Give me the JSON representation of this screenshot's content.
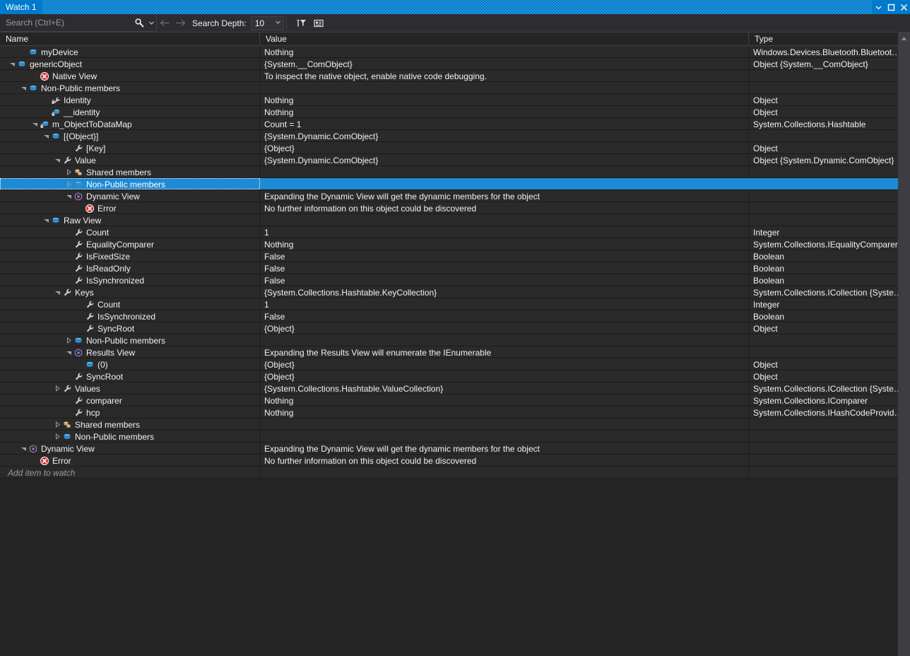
{
  "window": {
    "title": "Watch 1",
    "buttons": {
      "dropdown": "window-dropdown",
      "maximize": "maximize",
      "close": "close"
    }
  },
  "toolbar": {
    "search_placeholder": "Search (Ctrl+E)",
    "search_value": "",
    "search_icon": "magnifier-icon",
    "search_dropdown_icon": "chevron-down-icon",
    "back_icon": "arrow-left-icon",
    "forward_icon": "arrow-right-icon",
    "depth_label": "Search Depth:",
    "depth_value": "10",
    "pin_filter_icon": "pin-filter-icon",
    "hex_display_icon": "hexadecimal-display-icon"
  },
  "colors": {
    "accent": "#007acc",
    "selection": "#1e8ad6",
    "row_bg": "#2a2a2b",
    "panel_bg": "#252526",
    "toolbar_bg": "#2d2d30",
    "grid_line": "#1c1c1c",
    "text": "#f1f1f1",
    "muted_text": "#9a9a9a",
    "error_red": "#cf2b2b",
    "dynamic_purple": "#a074c4",
    "field_blue": "#3f9fe0",
    "property_gray": "#c5c5c5",
    "shared_tan": "#e8c39e"
  },
  "columns": [
    {
      "key": "name",
      "label": "Name"
    },
    {
      "key": "value",
      "label": "Value"
    },
    {
      "key": "type",
      "label": "Type"
    }
  ],
  "rows": [
    {
      "depth": 1,
      "expander": "none",
      "icon": "field-icon",
      "name": "myDevice",
      "value": "Nothing",
      "type": "Windows.Devices.Bluetooth.Bluetoot…"
    },
    {
      "depth": 0,
      "expander": "expanded",
      "icon": "field-icon",
      "name": "genericObject",
      "value": "{System.__ComObject}",
      "type": "Object {System.__ComObject}"
    },
    {
      "depth": 2,
      "expander": "none",
      "icon": "error-icon",
      "name": "Native View",
      "value": "To inspect the native object, enable native code debugging.",
      "type": ""
    },
    {
      "depth": 1,
      "expander": "expanded",
      "icon": "field-icon",
      "name": "Non-Public members",
      "value": "",
      "type": ""
    },
    {
      "depth": 3,
      "expander": "none",
      "icon": "private-property-icon",
      "name": "Identity",
      "value": "Nothing",
      "type": "Object"
    },
    {
      "depth": 3,
      "expander": "none",
      "icon": "private-field-icon",
      "name": "__identity",
      "value": "Nothing",
      "type": "Object"
    },
    {
      "depth": 2,
      "expander": "expanded",
      "icon": "private-field-icon",
      "name": "m_ObjectToDataMap",
      "value": "Count = 1",
      "type": "System.Collections.Hashtable"
    },
    {
      "depth": 3,
      "expander": "expanded",
      "icon": "field-icon",
      "name": "[{Object}]",
      "value": "{System.Dynamic.ComObject}",
      "type": ""
    },
    {
      "depth": 5,
      "expander": "none",
      "icon": "property-icon",
      "name": "[Key]",
      "value": "{Object}",
      "type": "Object"
    },
    {
      "depth": 4,
      "expander": "expanded",
      "icon": "property-icon",
      "name": "Value",
      "value": "{System.Dynamic.ComObject}",
      "type": "Object {System.Dynamic.ComObject}"
    },
    {
      "depth": 5,
      "expander": "collapsed",
      "icon": "shared-members-icon",
      "name": "Shared members",
      "value": "",
      "type": ""
    },
    {
      "depth": 5,
      "expander": "collapsed",
      "icon": "field-icon",
      "name": "Non-Public members",
      "value": "",
      "type": "",
      "selected": true
    },
    {
      "depth": 5,
      "expander": "expanded",
      "icon": "dynamic-view-icon",
      "name": "Dynamic View",
      "value": "Expanding the Dynamic View will get the dynamic members for the object",
      "type": ""
    },
    {
      "depth": 6,
      "expander": "none",
      "icon": "error-icon",
      "name": "Error",
      "value": "No further information on this object could be discovered",
      "type": ""
    },
    {
      "depth": 3,
      "expander": "expanded",
      "icon": "field-icon",
      "name": "Raw View",
      "value": "",
      "type": ""
    },
    {
      "depth": 5,
      "expander": "none",
      "icon": "property-icon",
      "name": "Count",
      "value": "1",
      "type": "Integer"
    },
    {
      "depth": 5,
      "expander": "none",
      "icon": "property-icon",
      "name": "EqualityComparer",
      "value": "Nothing",
      "type": "System.Collections.IEqualityComparer"
    },
    {
      "depth": 5,
      "expander": "none",
      "icon": "property-icon",
      "name": "IsFixedSize",
      "value": "False",
      "type": "Boolean"
    },
    {
      "depth": 5,
      "expander": "none",
      "icon": "property-icon",
      "name": "IsReadOnly",
      "value": "False",
      "type": "Boolean"
    },
    {
      "depth": 5,
      "expander": "none",
      "icon": "property-icon",
      "name": "IsSynchronized",
      "value": "False",
      "type": "Boolean"
    },
    {
      "depth": 4,
      "expander": "expanded",
      "icon": "property-icon",
      "name": "Keys",
      "value": "{System.Collections.Hashtable.KeyCollection}",
      "type": "System.Collections.ICollection {Syste…"
    },
    {
      "depth": 6,
      "expander": "none",
      "icon": "property-icon",
      "name": "Count",
      "value": "1",
      "type": "Integer"
    },
    {
      "depth": 6,
      "expander": "none",
      "icon": "property-icon",
      "name": "IsSynchronized",
      "value": "False",
      "type": "Boolean"
    },
    {
      "depth": 6,
      "expander": "none",
      "icon": "property-icon",
      "name": "SyncRoot",
      "value": "{Object}",
      "type": "Object"
    },
    {
      "depth": 5,
      "expander": "collapsed",
      "icon": "field-icon",
      "name": "Non-Public members",
      "value": "",
      "type": ""
    },
    {
      "depth": 5,
      "expander": "expanded",
      "icon": "dynamic-view-icon",
      "name": "Results View",
      "value": "Expanding the Results View will enumerate the IEnumerable",
      "type": ""
    },
    {
      "depth": 6,
      "expander": "none",
      "icon": "field-icon",
      "name": "(0)",
      "value": "{Object}",
      "type": "Object"
    },
    {
      "depth": 5,
      "expander": "none",
      "icon": "property-icon",
      "name": "SyncRoot",
      "value": "{Object}",
      "type": "Object"
    },
    {
      "depth": 4,
      "expander": "collapsed",
      "icon": "property-icon",
      "name": "Values",
      "value": "{System.Collections.Hashtable.ValueCollection}",
      "type": "System.Collections.ICollection {Syste…"
    },
    {
      "depth": 5,
      "expander": "none",
      "icon": "property-icon",
      "name": "comparer",
      "value": "Nothing",
      "type": "System.Collections.IComparer"
    },
    {
      "depth": 5,
      "expander": "none",
      "icon": "property-icon",
      "name": "hcp",
      "value": "Nothing",
      "type": "System.Collections.IHashCodeProvid…"
    },
    {
      "depth": 4,
      "expander": "collapsed",
      "icon": "shared-members-icon",
      "name": "Shared members",
      "value": "",
      "type": ""
    },
    {
      "depth": 4,
      "expander": "collapsed",
      "icon": "field-icon",
      "name": "Non-Public members",
      "value": "",
      "type": ""
    },
    {
      "depth": 1,
      "expander": "expanded",
      "icon": "dynamic-view-icon",
      "name": "Dynamic View",
      "value": "Expanding the Dynamic View will get the dynamic members for the object",
      "type": ""
    },
    {
      "depth": 2,
      "expander": "none",
      "icon": "error-icon",
      "name": "Error",
      "value": "No further information on this object could be discovered",
      "type": ""
    }
  ],
  "add_row": {
    "placeholder": "Add item to watch"
  },
  "scrollbar": {
    "up_arrow_icon": "scroll-up-icon"
  }
}
